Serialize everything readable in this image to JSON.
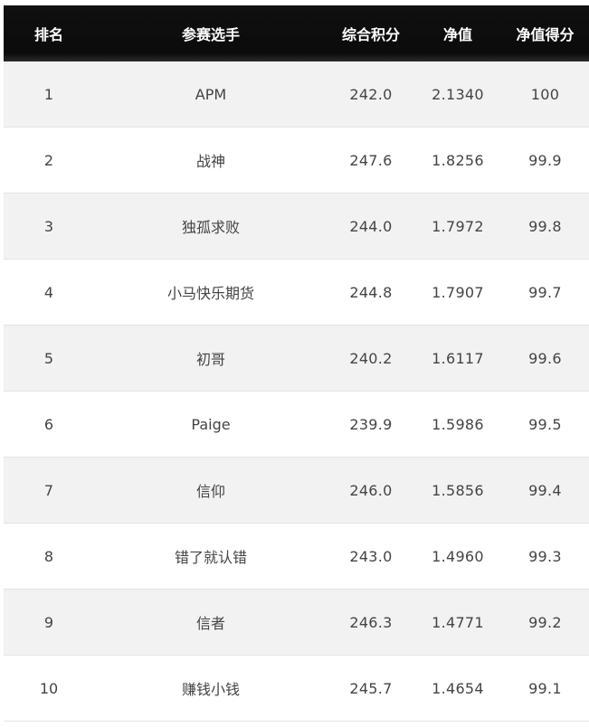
{
  "table": {
    "headers": [
      "排名",
      "参赛选手",
      "综合积分",
      "净值",
      "净值得分"
    ],
    "rows": [
      {
        "rank": "1",
        "name": "APM",
        "score": "242.0",
        "nav": "2.1340",
        "nav_score": "100"
      },
      {
        "rank": "2",
        "name": "战神",
        "score": "247.6",
        "nav": "1.8256",
        "nav_score": "99.9"
      },
      {
        "rank": "3",
        "name": "独孤求败",
        "score": "244.0",
        "nav": "1.7972",
        "nav_score": "99.8"
      },
      {
        "rank": "4",
        "name": "小马快乐期货",
        "score": "244.8",
        "nav": "1.7907",
        "nav_score": "99.7"
      },
      {
        "rank": "5",
        "name": "初哥",
        "score": "240.2",
        "nav": "1.6117",
        "nav_score": "99.6"
      },
      {
        "rank": "6",
        "name": "Paige",
        "score": "239.9",
        "nav": "1.5986",
        "nav_score": "99.5"
      },
      {
        "rank": "7",
        "name": "信仰",
        "score": "246.0",
        "nav": "1.5856",
        "nav_score": "99.4"
      },
      {
        "rank": "8",
        "name": "错了就认错",
        "score": "243.0",
        "nav": "1.4960",
        "nav_score": "99.3"
      },
      {
        "rank": "9",
        "name": "信者",
        "score": "246.3",
        "nav": "1.4771",
        "nav_score": "99.2"
      },
      {
        "rank": "10",
        "name": "赚钱小钱",
        "score": "245.7",
        "nav": "1.4654",
        "nav_score": "99.1"
      }
    ]
  },
  "colors": {
    "header_bg": "#0b0b0b",
    "header_text": "#ffffff",
    "row_odd": "#f2f2f2",
    "row_even": "#ffffff",
    "cell_text": "#444444"
  }
}
